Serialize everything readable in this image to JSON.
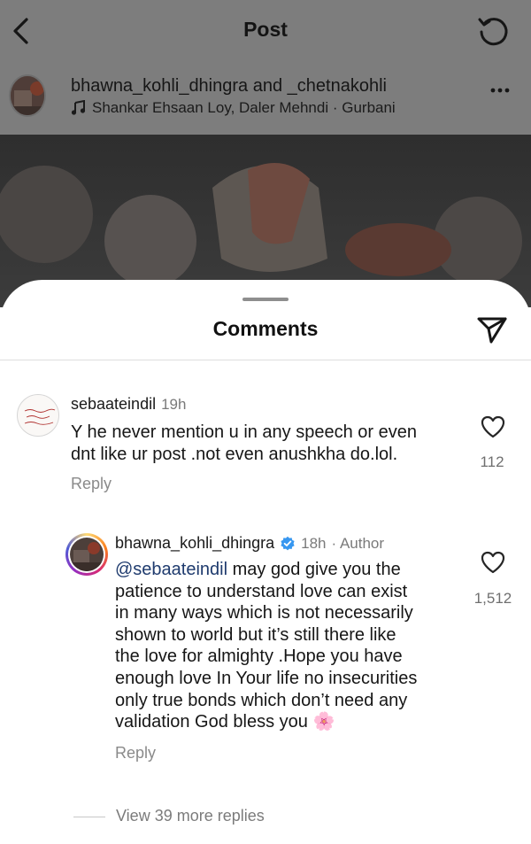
{
  "header": {
    "title": "Post",
    "back_icon": "chevron-left-icon",
    "refresh_icon": "refresh-icon"
  },
  "post": {
    "user_primary": "bhawna_kohli_dhingra",
    "joiner": "and",
    "user_secondary": "_chetnakohli",
    "audio": "Shankar Ehsaan Loy, Daler Mehndi · Gurbani",
    "audio_icon": "music-note-icon",
    "more_icon": "more-dots-icon"
  },
  "comments_sheet": {
    "title": "Comments",
    "share_icon": "send-icon"
  },
  "comments": [
    {
      "username": "sebaateindil",
      "time": "19h",
      "text": "Y he never mention u in any speech or even dnt like ur post .not even anushkha do.lol.",
      "line1": "Y he never mention u in any speech or even",
      "line2": "dnt like ur post .not even anushkha do.lol.",
      "likes": "112",
      "reply_label": "Reply",
      "avatar_text": "Loyal behind my back, Hate my type"
    }
  ],
  "reply": {
    "username": "bhawna_kohli_dhingra",
    "verified_icon": "verified-badge-icon",
    "time": "18h",
    "author_tag": "· Author",
    "mention": "@sebaateindil",
    "lines": [
      " may god give you the",
      "patience to understand love can exist",
      "in many ways which is not necessarily",
      "shown to world but it’s still there like",
      "the love for almighty .Hope  you have",
      "enough love In Your life no insecurities",
      "only true bonds which don’t need any",
      "validation God bless you "
    ],
    "emoji": "🌸",
    "likes": "1,512",
    "reply_label": "Reply"
  },
  "view_more": {
    "label": "View 39 more replies"
  },
  "colors": {
    "overlay": "#7d7d7d",
    "mention": "#1f3b6e",
    "verified": "#3797f0",
    "muted_text": "#8a8a8a"
  }
}
